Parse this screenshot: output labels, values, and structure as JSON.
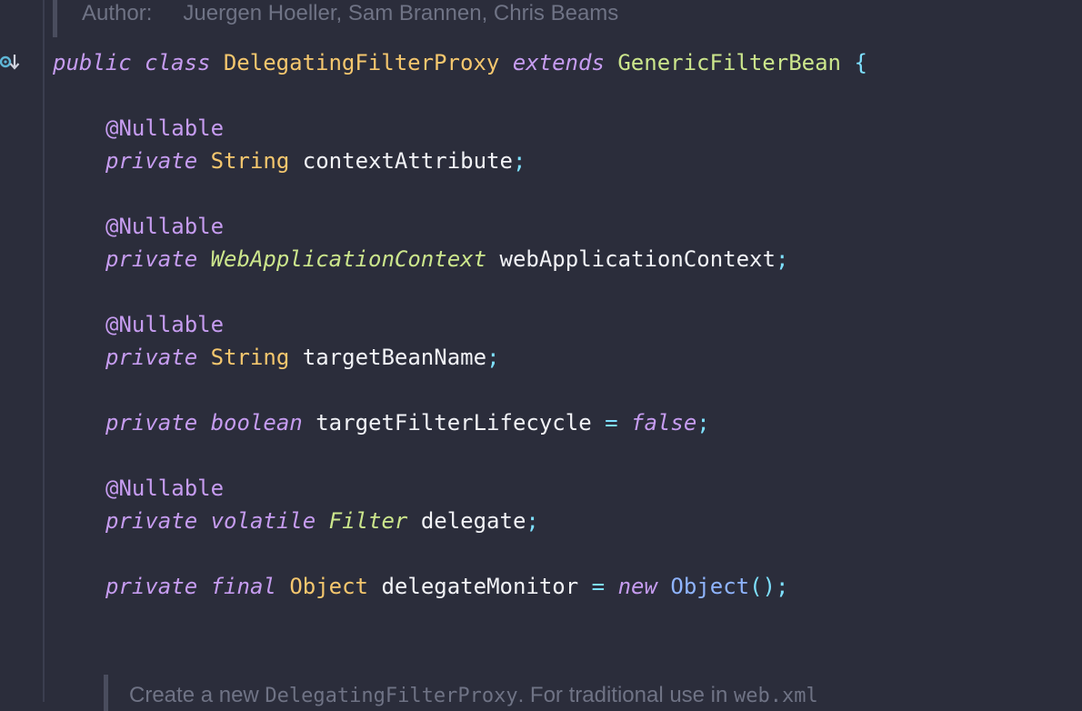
{
  "doc_header": {
    "author_label": "Author:",
    "author_names": "Juergen Hoeller, Sam Brannen, Chris Beams"
  },
  "gutter": {
    "icon": "override-down-arrow-icon"
  },
  "class_decl": {
    "modifier": "public",
    "keyword": "class",
    "name": "DelegatingFilterProxy",
    "extends_kw": "extends",
    "superclass": "GenericFilterBean",
    "brace": "{"
  },
  "fields": [
    {
      "annotation": "@Nullable",
      "modifiers": [
        "private"
      ],
      "type": "String",
      "name": "contextAttribute",
      "end": ";"
    },
    {
      "annotation": "@Nullable",
      "modifiers": [
        "private"
      ],
      "type": "WebApplicationContext",
      "name": "webApplicationContext",
      "end": ";"
    },
    {
      "annotation": "@Nullable",
      "modifiers": [
        "private"
      ],
      "type": "String",
      "name": "targetBeanName",
      "end": ";"
    },
    {
      "modifiers": [
        "private",
        "boolean"
      ],
      "name": "targetFilterLifecycle",
      "op": "=",
      "value": "false",
      "end": ";"
    },
    {
      "annotation": "@Nullable",
      "modifiers": [
        "private",
        "volatile"
      ],
      "type": "Filter",
      "name": "delegate",
      "end": ";"
    },
    {
      "modifiers": [
        "private",
        "final"
      ],
      "type": "Object",
      "name": "delegateMonitor",
      "op": "=",
      "new_kw": "new",
      "ctor": "Object",
      "call": "()",
      "end": ";"
    }
  ],
  "doc_footer": {
    "text_a": "Create a new ",
    "code": "DelegatingFilterProxy",
    "text_b": ". For traditional use in ",
    "code2": "web.xml"
  },
  "colors": {
    "background": "#2b2d3b",
    "keyword": "#c69cf0",
    "type": "#f5c76e",
    "interface_type": "#cce68c",
    "punctuation": "#7ee0ff",
    "identifier": "#f2f3f7",
    "doc_text": "#6f7385"
  }
}
